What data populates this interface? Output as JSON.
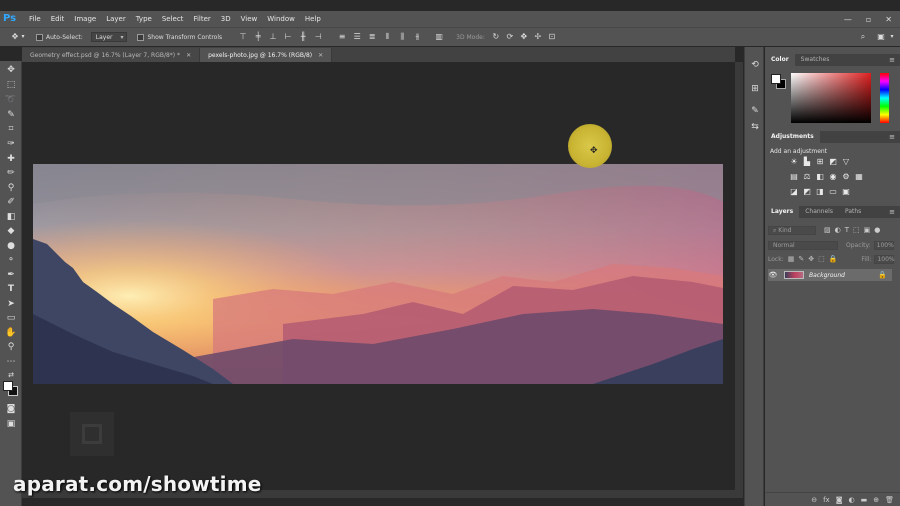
{
  "menu": {
    "logo": "Ps",
    "items": [
      "File",
      "Edit",
      "Image",
      "Layer",
      "Type",
      "Select",
      "Filter",
      "3D",
      "View",
      "Window",
      "Help"
    ],
    "window_controls": [
      "—",
      "▫",
      "✕"
    ]
  },
  "options": {
    "auto_select_label": "Auto-Select:",
    "auto_select_value": "Layer",
    "transform_label": "Show Transform Controls",
    "mode_3d_label": "3D Mode:"
  },
  "tabs": [
    {
      "label": "Geometry effect.psd @ 16.7% (Layer 7, RGB/8*) *",
      "close": "✕",
      "active": false
    },
    {
      "label": "pexels-photo.jpg @ 16.7% (RGB/8)",
      "close": "✕",
      "active": true
    }
  ],
  "panels": {
    "color": {
      "tabs": [
        "Color",
        "Swatches"
      ],
      "menu": "≡"
    },
    "adjustments": {
      "tabs": [
        "Adjustments"
      ],
      "title": "Add an adjustment",
      "menu": "≡"
    },
    "layers": {
      "tabs": [
        "Layers",
        "Channels",
        "Paths"
      ],
      "menu": "≡",
      "kind_label": "Kind",
      "blend_mode": "Normal",
      "opacity_label": "Opacity:",
      "opacity_value": "100%",
      "lock_label": "Lock:",
      "fill_label": "Fill:",
      "fill_value": "100%",
      "layer_name": "Background"
    }
  },
  "watermark": "aparat.com/showtime",
  "colors": {
    "accent": "#31a8ff",
    "chrome": "#535353",
    "canvas": "#282828"
  }
}
